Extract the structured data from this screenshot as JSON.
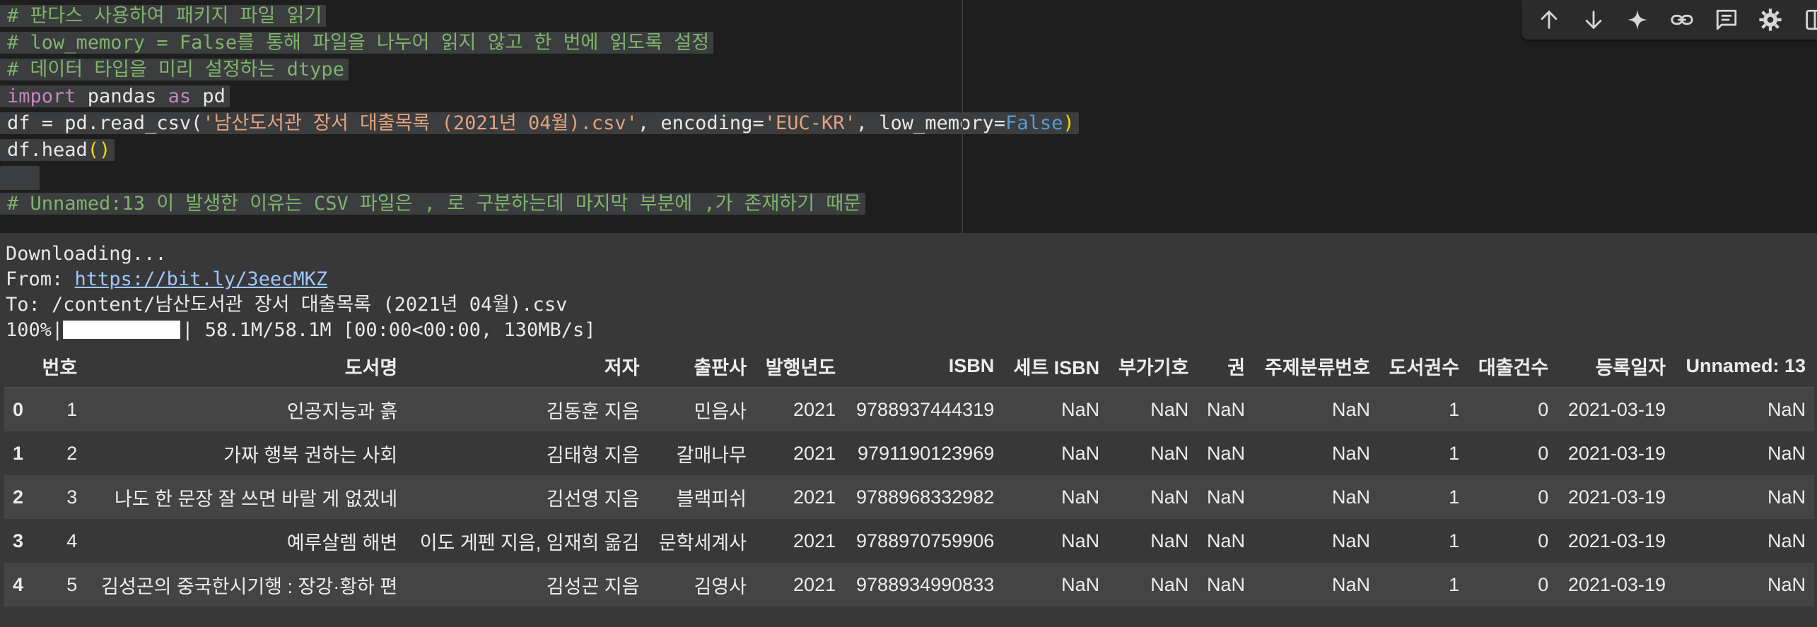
{
  "code": {
    "line1": "# 판다스 사용하여 패키지 파일 읽기",
    "line2": "# low_memory = False를 통해 파일을 나누어 읽지 않고 한 번에 읽도록 설정",
    "line3": "# 데이터 타입을 미리 설정하는 dtype",
    "line4_kw1": "import",
    "line4_mod": " pandas ",
    "line4_kw2": "as",
    "line4_alias": " pd",
    "line5_a": "df = pd.read_csv(",
    "line5_str1": "'남산도서관 장서 대출목록 (2021년 04월).csv'",
    "line5_b": ", encoding=",
    "line5_str2": "'EUC-KR'",
    "line5_c": ", low_memory=",
    "line5_false": "False",
    "line5_close": ")",
    "line6_a": "df.head",
    "line6_paren": "()",
    "line8": "# Unnamed:13 이 발생한 이유는 CSV 파일은 , 로 구분하는데 마지막 부분에 ,가 존재하기 때문"
  },
  "toolbar": {
    "icons": [
      "arrow-up-icon",
      "arrow-down-icon",
      "sparkle-icon",
      "link-icon",
      "comment-icon",
      "gear-icon",
      "mirror-icon"
    ]
  },
  "output": {
    "downloading": "Downloading...",
    "from_label": "From: ",
    "from_url": "https://bit.ly/3eecMKZ",
    "to_line": "To: /content/남산도서관 장서 대출목록 (2021년 04월).csv",
    "progress_pct": "100%|",
    "progress_value": 1.0,
    "progress_rest": "| 58.1M/58.1M [00:00<00:00, 130MB/s]"
  },
  "table": {
    "columns": [
      "",
      "번호",
      "도서명",
      "저자",
      "출판사",
      "발행년도",
      "ISBN",
      "세트 ISBN",
      "부가기호",
      "권",
      "주제분류번호",
      "도서권수",
      "대출건수",
      "등록일자",
      "Unnamed: 13"
    ],
    "rows": [
      [
        "0",
        "1",
        "인공지능과 흙",
        "김동훈 지음",
        "민음사",
        "2021",
        "9788937444319",
        "NaN",
        "NaN",
        "NaN",
        "NaN",
        "1",
        "0",
        "2021-03-19",
        "NaN"
      ],
      [
        "1",
        "2",
        "가짜 행복 권하는 사회",
        "김태형 지음",
        "갈매나무",
        "2021",
        "9791190123969",
        "NaN",
        "NaN",
        "NaN",
        "NaN",
        "1",
        "0",
        "2021-03-19",
        "NaN"
      ],
      [
        "2",
        "3",
        "나도 한 문장 잘 쓰면 바랄 게 없겠네",
        "김선영 지음",
        "블랙피쉬",
        "2021",
        "9788968332982",
        "NaN",
        "NaN",
        "NaN",
        "NaN",
        "1",
        "0",
        "2021-03-19",
        "NaN"
      ],
      [
        "3",
        "4",
        "예루살렘 해변",
        "이도 게펜 지음, 임재희 옮김",
        "문학세계사",
        "2021",
        "9788970759906",
        "NaN",
        "NaN",
        "NaN",
        "NaN",
        "1",
        "0",
        "2021-03-19",
        "NaN"
      ],
      [
        "4",
        "5",
        "김성곤의 중국한시기행 : 장강·황하 편",
        "김성곤 지음",
        "김영사",
        "2021",
        "9788934990833",
        "NaN",
        "NaN",
        "NaN",
        "NaN",
        "1",
        "0",
        "2021-03-19",
        "NaN"
      ]
    ]
  }
}
